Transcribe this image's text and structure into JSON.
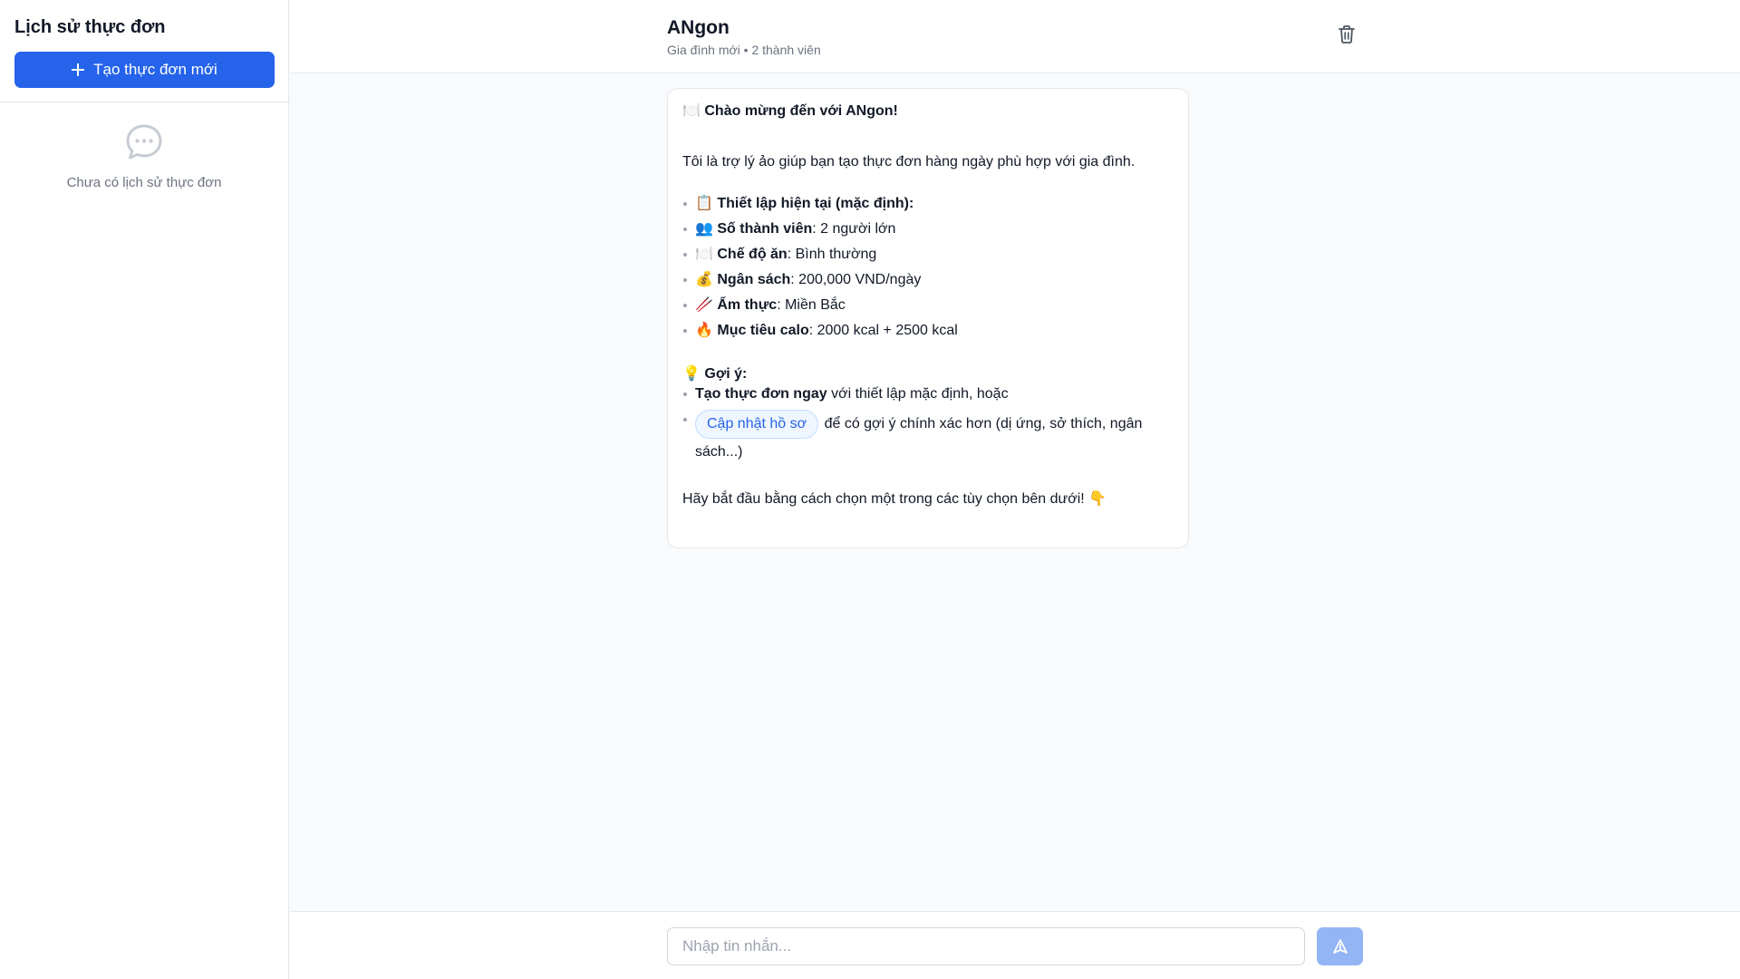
{
  "sidebar": {
    "title": "Lịch sử thực đơn",
    "new_button_label": "Tạo thực đơn mới",
    "empty_text": "Chưa có lịch sử thực đơn"
  },
  "header": {
    "title": "ANgon",
    "subtitle": "Gia đình mới • 2 thành viên"
  },
  "message": {
    "welcome": "🍽️ Chào mừng đến với ANgon!",
    "intro": "Tôi là trợ lý ảo giúp bạn tạo thực đơn hàng ngày phù hợp với gia đình.",
    "settings": [
      {
        "label": "📋 Thiết lập hiện tại (mặc định):",
        "value": ""
      },
      {
        "label": "👥 Số thành viên",
        "value": ": 2 người lớn"
      },
      {
        "label": "🍽️ Chế độ ăn",
        "value": ": Bình thường"
      },
      {
        "label": "💰 Ngân sách",
        "value": ": 200,000 VND/ngày"
      },
      {
        "label": "🥢 Ẩm thực",
        "value": ": Miền Bắc"
      },
      {
        "label": "🔥 Mục tiêu calo",
        "value": ": 2000 kcal + 2500 kcal"
      }
    ],
    "tip_title": "💡 Gợi ý:",
    "tip1_bold": "Tạo thực đơn ngay",
    "tip1_rest": " với thiết lập mặc định, hoặc",
    "tip2_button": "Cập nhật hồ sơ",
    "tip2_rest": " để có gợi ý chính xác hơn (dị ứng, sở thích, ngân sách...)",
    "closing": "Hãy bắt đầu bằng cách chọn một trong các tùy chọn bên dưới! 👇"
  },
  "input": {
    "placeholder": "Nhập tin nhắn...",
    "value": ""
  },
  "colors": {
    "primary": "#2563eb",
    "send_disabled": "#93b4f5",
    "border": "#e5e7eb",
    "muted_text": "#6b7280"
  },
  "icons": {
    "plus": "plus-icon",
    "empty": "chat-bubble-icon",
    "trash": "trash-icon",
    "send": "send-icon"
  }
}
